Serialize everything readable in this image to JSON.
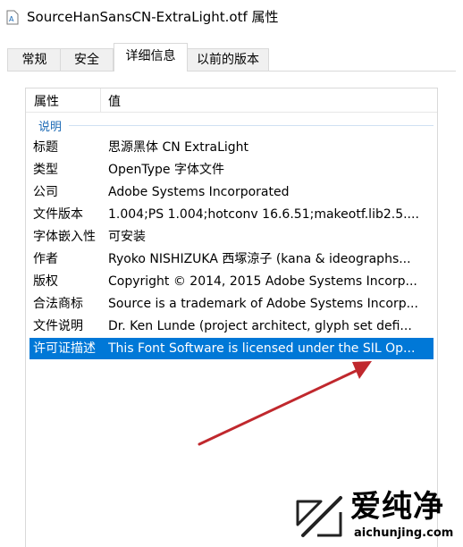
{
  "window": {
    "title": "SourceHanSansCN-ExtraLight.otf 属性"
  },
  "tabs": [
    {
      "label": "常规",
      "active": false
    },
    {
      "label": "安全",
      "active": false
    },
    {
      "label": "详细信息",
      "active": true
    },
    {
      "label": "以前的版本",
      "active": false
    }
  ],
  "details": {
    "header": {
      "property": "属性",
      "value": "值"
    },
    "section": "说明",
    "rows": [
      {
        "key": "标题",
        "value": "思源黑体 CN ExtraLight"
      },
      {
        "key": "类型",
        "value": "OpenType 字体文件"
      },
      {
        "key": "公司",
        "value": "Adobe Systems Incorporated"
      },
      {
        "key": "文件版本",
        "value": "1.004;PS 1.004;hotconv 16.6.51;makeotf.lib2.5...."
      },
      {
        "key": "字体嵌入性",
        "value": "可安装"
      },
      {
        "key": "作者",
        "value": "Ryoko NISHIZUKA 西塚涼子 (kana & ideographs..."
      },
      {
        "key": "版权",
        "value": "Copyright © 2014, 2015 Adobe Systems Incorp..."
      },
      {
        "key": "合法商标",
        "value": "Source is a trademark of Adobe Systems Incorp..."
      },
      {
        "key": "文件说明",
        "value": "Dr. Ken Lunde (project architect, glyph set defi..."
      },
      {
        "key": "许可证描述",
        "value": "This Font Software is licensed under the SIL Op...",
        "selected": true
      }
    ]
  },
  "colors": {
    "selection": "#0078d7",
    "section": "#1c6ab5",
    "arrow": "#c0282d"
  },
  "watermark": {
    "name": "爱纯净",
    "url": "aichunjing.com"
  }
}
